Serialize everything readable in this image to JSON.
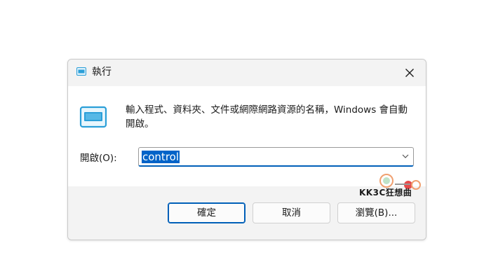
{
  "window": {
    "title": "執行",
    "icon": "run-icon",
    "close_icon": "close-icon"
  },
  "content": {
    "description": "輸入程式、資料夾、文件或網際網路資源的名稱，Windows 會自動開啟。",
    "open_label": "開啟(O):",
    "open_value": "control",
    "dropdown_icon": "chevron-down-icon"
  },
  "buttons": {
    "ok": "確定",
    "cancel": "取消",
    "browse": "瀏覽(B)..."
  },
  "watermark": {
    "text": "KK3C狂想曲"
  },
  "colors": {
    "accent": "#005fb8",
    "selection": "#0063c8",
    "icon_blue": "#2b9fd8"
  }
}
